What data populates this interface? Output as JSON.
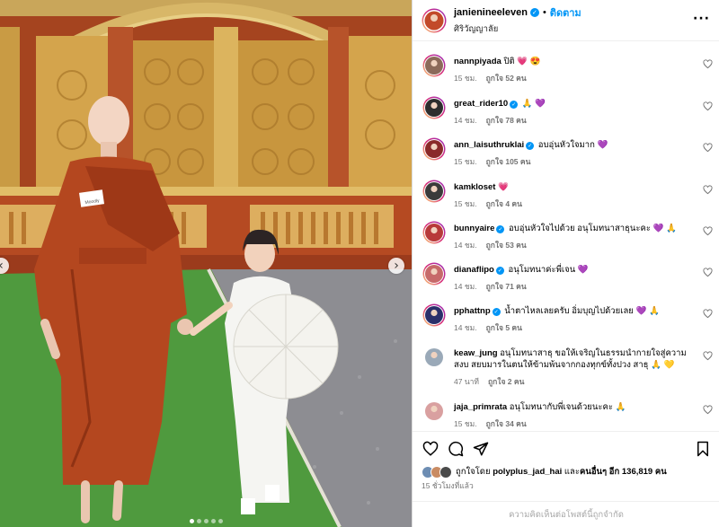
{
  "post": {
    "username": "janienineeleven",
    "follow_label": "ติดตาม",
    "separator": "•",
    "location": "ศิริวัญญาลัย",
    "more_icon": "more-horizontal-icon",
    "verified_mark": "✓",
    "name_tag": "Moodly",
    "carousel": {
      "total": 5,
      "active": 1
    }
  },
  "comments": [
    {
      "user": "nannpiyada",
      "verified": false,
      "text": "ปิติ 💗 😍",
      "time": "15 ชม.",
      "likes": "ถูกใจ 52 คน"
    },
    {
      "user": "great_rider10",
      "verified": true,
      "text": "🙏 💜",
      "time": "14 ชม.",
      "likes": "ถูกใจ 78 คน"
    },
    {
      "user": "ann_laisuthruklai",
      "verified": true,
      "text": "อบอุ่นหัวใจมาก 💜",
      "time": "15 ชม.",
      "likes": "ถูกใจ 105 คน"
    },
    {
      "user": "kamkloset",
      "verified": false,
      "text": "💗",
      "time": "15 ชม.",
      "likes": "ถูกใจ 4 คน"
    },
    {
      "user": "bunnyaire",
      "verified": true,
      "text": "อบอุ่นหัวใจไปด้วย อนุโมทนาสาธุนะคะ 💜 🙏",
      "time": "14 ชม.",
      "likes": "ถูกใจ 53 คน"
    },
    {
      "user": "dianaflipo",
      "verified": true,
      "text": "อนุโมทนาค่ะพี่เจน 💜",
      "time": "14 ชม.",
      "likes": "ถูกใจ 71 คน"
    },
    {
      "user": "pphattnp",
      "verified": true,
      "text": "น้ำตาไหลเลยครับ อิ่มบุญไปด้วยเลย 💜 🙏",
      "time": "14 ชม.",
      "likes": "ถูกใจ 5 คน"
    },
    {
      "user": "keaw_jung",
      "verified": false,
      "text": "อนุโมทนาสาธุ ขอให้เจริญในธรรมนำกายใจสู่ความสงบ สยบมารในตนให้ข้ามพ้นจากกองทุกข์ทั้งปวง สาธุ 🙏 💛",
      "time": "47 นาที",
      "likes": "ถูกใจ 2 คน"
    },
    {
      "user": "jaja_primrata",
      "verified": false,
      "text": "อนุโมทนากับพี่เจนด้วยนะคะ 🙏",
      "time": "15 ชม.",
      "likes": "ถูกใจ 34 คน"
    }
  ],
  "footer": {
    "liked_prefix": "ถูกใจโดย",
    "liked_user": "polyplus_jad_hai",
    "liked_mid": "และ",
    "liked_others": "คนอื่นๆ อีก 136,819 คน",
    "time": "15 ชั่วโมงที่แล้ว",
    "comments_limited": "ความคิดเห็นต่อโพสต์นี้ถูกจำกัด"
  },
  "colors": {
    "accent": "#0095f6",
    "muted": "#737373",
    "robe": "#b4471f",
    "border": "#dbdbdb"
  },
  "icons": [
    "heart-icon",
    "comment-icon",
    "share-icon",
    "bookmark-icon",
    "chevron-right-icon",
    "verified-badge-icon"
  ]
}
